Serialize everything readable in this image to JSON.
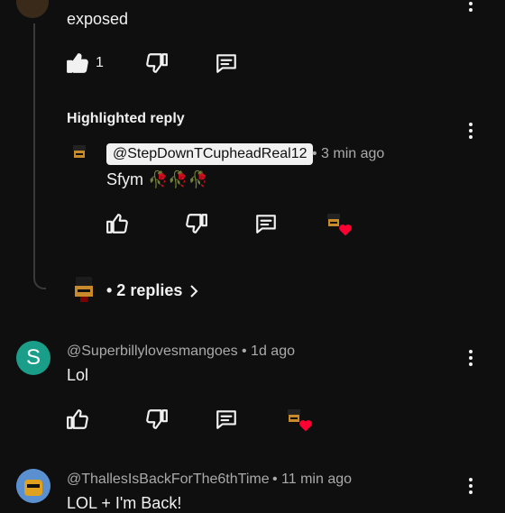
{
  "colors": {
    "background": "#0f0f0f",
    "text": "#f1f1f1",
    "muted": "#aaaaaa",
    "heart": "#ff0033",
    "teal_avatar": "#1a9e8a"
  },
  "top_comment": {
    "text": "exposed",
    "likes": "1"
  },
  "highlighted_reply": {
    "label": "Highlighted reply",
    "author": "@StepDownTCupheadReal12",
    "time": "• 3 min ago",
    "text": "Sfym 🥀🥀🥀"
  },
  "more_replies": {
    "label": "• 2 replies"
  },
  "comment_superbilly": {
    "author": "@Superbillylovesmangoes",
    "time": "• 1d ago",
    "avatar_letter": "S",
    "text": "Lol"
  },
  "comment_thalles": {
    "author": "@ThallesIsBackForThe6thTime",
    "time": "• 11 min ago",
    "text": "LOL + I'm Back!"
  },
  "icons": {
    "like": "thumb-up-icon",
    "dislike": "thumb-down-icon",
    "reply": "comment-icon",
    "more": "more-vert-icon",
    "heart": "heart-icon",
    "chevron": "chevron-right-icon"
  }
}
